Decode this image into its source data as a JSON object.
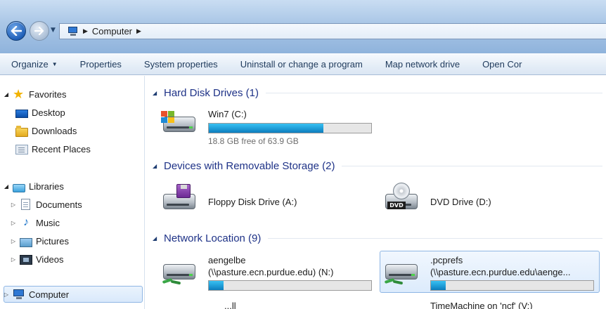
{
  "address_bar": {
    "crumbs": [
      "Computer"
    ]
  },
  "toolbar": {
    "organize": "Organize",
    "properties": "Properties",
    "system_properties": "System properties",
    "uninstall": "Uninstall or change a program",
    "map_drive": "Map network drive",
    "open_control": "Open Cor"
  },
  "sidebar": {
    "favorites": {
      "label": "Favorites",
      "items": [
        {
          "label": "Desktop",
          "icon": "desktop-icon"
        },
        {
          "label": "Downloads",
          "icon": "folder-icon"
        },
        {
          "label": "Recent Places",
          "icon": "recent-places-icon"
        }
      ]
    },
    "libraries": {
      "label": "Libraries",
      "items": [
        {
          "label": "Documents",
          "icon": "documents-icon"
        },
        {
          "label": "Music",
          "icon": "music-icon"
        },
        {
          "label": "Pictures",
          "icon": "pictures-icon"
        },
        {
          "label": "Videos",
          "icon": "videos-icon"
        }
      ]
    },
    "computer": {
      "label": "Computer"
    }
  },
  "groups": {
    "hard_disks": {
      "title": "Hard Disk Drives (1)",
      "drives": [
        {
          "name": "Win7 (C:)",
          "free_text": "18.8 GB free of 63.9 GB",
          "used_fraction": 0.706
        }
      ]
    },
    "removable": {
      "title": "Devices with Removable Storage (2)",
      "drives": [
        {
          "name": "Floppy Disk Drive (A:)"
        },
        {
          "name": "DVD Drive (D:)",
          "badge": "DVD"
        }
      ]
    },
    "network": {
      "title": "Network Location (9)",
      "drives": [
        {
          "name": "aengelbe",
          "path": "(\\\\pasture.ecn.purdue.edu) (N:)",
          "used_fraction": 0.09
        },
        {
          "name": ".pcprefs",
          "path": "(\\\\pasture.ecn.purdue.edu\\aenge...",
          "used_fraction": 0.09
        }
      ],
      "partial_items": [
        "...ll",
        "TimeMachine on 'ncf' (V:)"
      ]
    }
  },
  "colors": {
    "group_title": "#1e3287",
    "bar_fill": "#23a3dc",
    "selection": "#dcebfc"
  }
}
